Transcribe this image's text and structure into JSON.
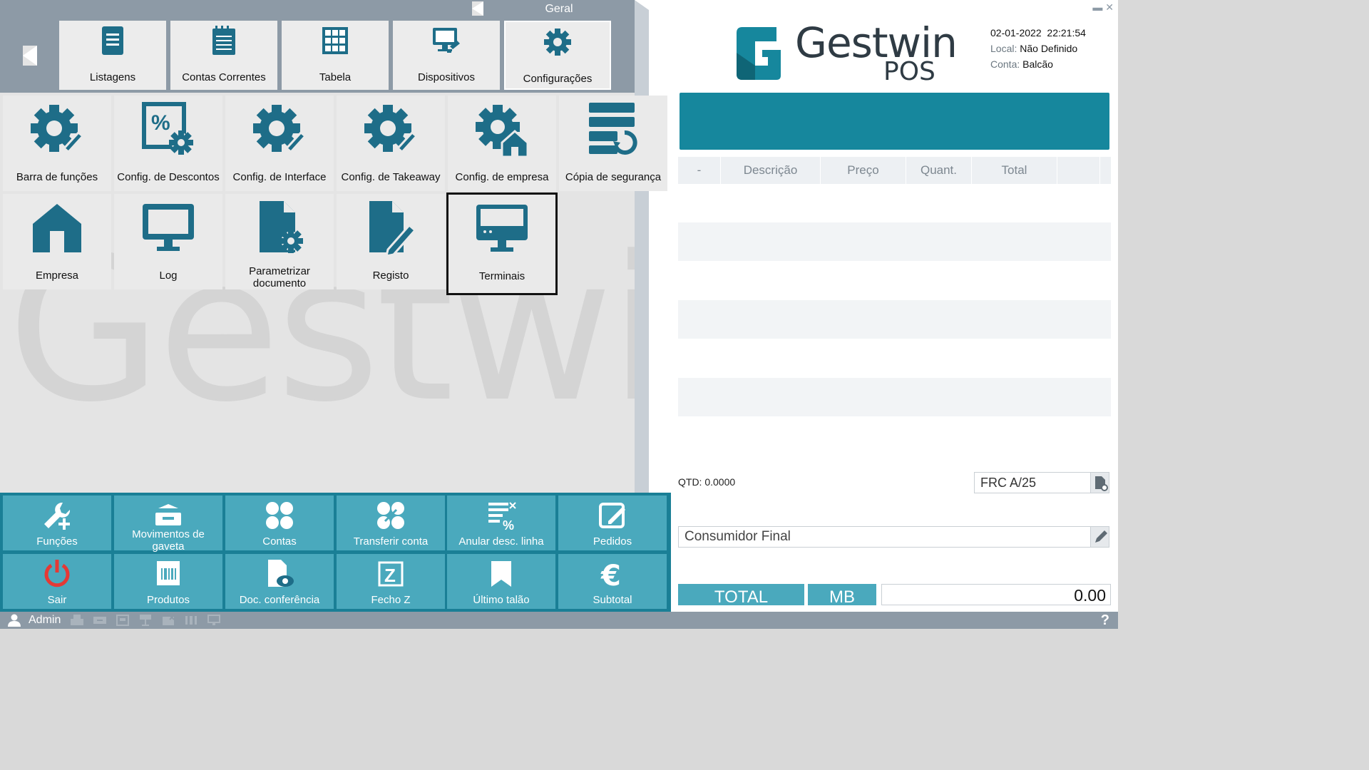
{
  "header": {
    "group_title": "Geral",
    "tabs": [
      {
        "label": "Listagens",
        "icon": "list-document-icon"
      },
      {
        "label": "Contas Correntes",
        "icon": "notepad-icon"
      },
      {
        "label": "Tabela",
        "icon": "grid-table-icon"
      },
      {
        "label": "Dispositivos",
        "icon": "monitor-plug-icon"
      },
      {
        "label": "Configurações",
        "icon": "gear-icon",
        "active": true
      }
    ]
  },
  "tiles": [
    {
      "label": "Barra de funções",
      "icon": "gear-brush-icon"
    },
    {
      "label": "Config. de Descontos",
      "icon": "percent-gear-icon"
    },
    {
      "label": "Config. de Interface",
      "icon": "gear-brush-icon"
    },
    {
      "label": "Config. de Takeaway",
      "icon": "gear-brush-icon"
    },
    {
      "label": "Config. de empresa",
      "icon": "gear-house-icon"
    },
    {
      "label": "Cópia de segurança",
      "icon": "backup-restore-icon"
    },
    {
      "label": "Empresa",
      "icon": "house-icon"
    },
    {
      "label": "Log",
      "icon": "monitor-icon"
    },
    {
      "label": "Parametrizar documento",
      "icon": "document-gear-icon"
    },
    {
      "label": "Registo",
      "icon": "document-pen-icon"
    },
    {
      "label": "Terminais",
      "icon": "terminal-monitor-icon",
      "selected": true
    }
  ],
  "watermark": "Gestwin",
  "functions": [
    {
      "label": "Funções",
      "icon": "wrench-plus-icon"
    },
    {
      "label": "Movimentos de gaveta",
      "icon": "cash-drawer-icon"
    },
    {
      "label": "Contas",
      "icon": "four-circles-icon"
    },
    {
      "label": "Transferir conta",
      "icon": "transfer-circles-icon"
    },
    {
      "label": "Anular desc. linha",
      "icon": "cancel-discount-icon"
    },
    {
      "label": "Pedidos",
      "icon": "edit-square-icon"
    },
    {
      "label": "Sair",
      "icon": "power-icon"
    },
    {
      "label": "Produtos",
      "icon": "barcode-box-icon"
    },
    {
      "label": "Doc. conferência",
      "icon": "document-eye-icon"
    },
    {
      "label": "Fecho Z",
      "icon": "z-box-icon"
    },
    {
      "label": "Último talão",
      "icon": "receipt-icon"
    },
    {
      "label": "Subtotal",
      "icon": "euro-icon"
    }
  ],
  "status": {
    "user": "Admin",
    "help": "?"
  },
  "brand": {
    "name": "Gestwin",
    "sub": "POS"
  },
  "session": {
    "date": "02-01-2022",
    "time": "22:21:54",
    "local_label": "Local:",
    "local_value": "Não Definido",
    "conta_label": "Conta:",
    "conta_value": "Balcão"
  },
  "table": {
    "columns": [
      "-",
      "Descrição",
      "Preço",
      "Quant.",
      "Total"
    ]
  },
  "qtd": "QTD: 0.0000",
  "doc_type": "FRC A/25",
  "customer": "Consumidor Final",
  "totals": {
    "total_label": "TOTAL",
    "payment_label": "MB",
    "value": "0.00"
  },
  "colors": {
    "accent": "#16879d",
    "button": "#4aa9bd",
    "icon": "#1e6d88",
    "nav": "#8d9aa6",
    "power": "#e53935"
  }
}
